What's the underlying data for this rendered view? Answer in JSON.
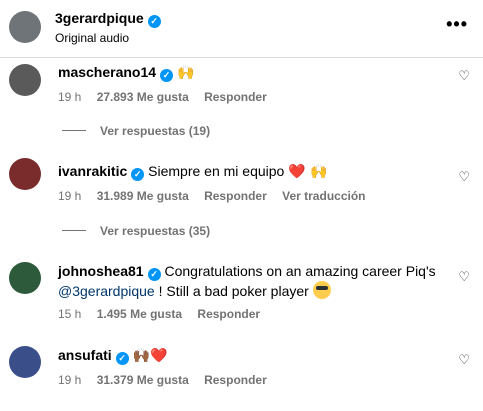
{
  "post": {
    "owner": "3gerardpique",
    "audio": "Original audio",
    "more_icon": "•••"
  },
  "comments": [
    {
      "user": "mascherano14",
      "text": "",
      "emoji": "🙌",
      "time": "19 h",
      "likes": "27.893 Me gusta",
      "reply": "Responder",
      "view_replies": "Ver respuestas (19)"
    },
    {
      "user": "ivanrakitic",
      "text": "Siempre en mi equipo",
      "emoji": "❤️ 🙌",
      "time": "19 h",
      "likes": "31.989 Me gusta",
      "reply": "Responder",
      "translate": "Ver traducción",
      "view_replies": "Ver respuestas (35)"
    },
    {
      "user": "johnoshea81",
      "text": "Congratulations on an amazing career Piq's",
      "mention": "@3gerardpique",
      "text2": " ! Still a bad poker player",
      "time": "15 h",
      "likes": "1.495 Me gusta",
      "reply": "Responder"
    },
    {
      "user": "ansufati",
      "text": "",
      "emoji": "🙌🏾❤️",
      "time": "19 h",
      "likes": "31.379 Me gusta",
      "reply": "Responder"
    }
  ],
  "icons": {
    "heart": "♡",
    "verified": "✓"
  },
  "colors": {
    "verified": "#0095f6",
    "meta": "#737373",
    "mention": "#00376b",
    "like_heart": "#ed4956"
  }
}
